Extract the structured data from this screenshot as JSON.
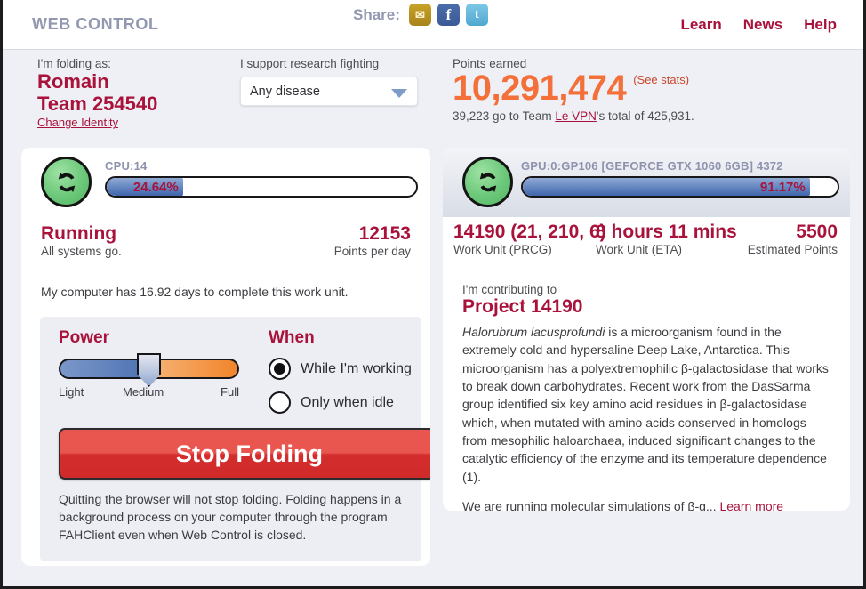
{
  "header": {
    "brand": "WEB CONTROL",
    "share_label": "Share:",
    "share_icons": [
      {
        "name": "email-share-icon",
        "glyph": "✉"
      },
      {
        "name": "facebook-share-icon",
        "glyph": "f"
      },
      {
        "name": "twitter-share-icon",
        "glyph": "t"
      }
    ],
    "nav": [
      {
        "label": "Learn"
      },
      {
        "label": "News"
      },
      {
        "label": "Help"
      }
    ],
    "link_color": "#a8123b"
  },
  "identity": {
    "folding_as_label": "I'm folding as:",
    "user_name": "Romain",
    "team": "Team 254540",
    "change_identity": "Change Identity"
  },
  "disease": {
    "label": "I support research fighting",
    "selected": "Any disease",
    "placeholder": "Any disease",
    "options": [
      "Any disease"
    ]
  },
  "points": {
    "label": "Points earned",
    "value": "10,291,474",
    "see_stats": "(See stats)",
    "note_prefix": "39,223 go to Team ",
    "team_link": "Le VPN",
    "note_suffix": "'s total of 425,931.",
    "accent_color": "#f4703a"
  },
  "slots": [
    {
      "id": "cpu",
      "status_icon": "refresh-icon",
      "name": "CPU:14",
      "progress_percent": 24.64,
      "progress_text": "24.64%",
      "active": true,
      "status_title": "Running",
      "status_sub": "All systems go.",
      "ppd_value": "12153",
      "ppd_label": "Points per day",
      "work_note": "My computer has 16.92 days to complete this work unit."
    },
    {
      "id": "gpu",
      "status_icon": "refresh-icon",
      "name": "GPU:0:GP106 [GEFORCE GTX 1060 6GB] 4372",
      "progress_percent": 91.17,
      "progress_text": "91.17%",
      "active": false,
      "prcg_value": "14190 (21, 210, 6)",
      "prcg_label": "Work Unit (PRCG)",
      "eta_value": "8 hours 11 mins",
      "eta_label": "Work Unit (ETA)",
      "est_value": "5500",
      "est_label": "Estimated Points"
    }
  ],
  "power": {
    "title": "Power",
    "level": "Medium",
    "labels": {
      "light": "Light",
      "medium": "Medium",
      "full": "Full"
    }
  },
  "when": {
    "title": "When",
    "options": [
      {
        "label": "While I'm working",
        "selected": true
      },
      {
        "label": "Only when idle",
        "selected": false
      }
    ]
  },
  "actions": {
    "stop_folding": "Stop Folding",
    "quit_note": "Quitting the browser will not stop folding. Folding happens in a background process on your computer through the program FAHClient even when Web Control is closed."
  },
  "project": {
    "contributing_label": "I'm contributing to",
    "title": "Project 14190",
    "organism": "Halorubrum lacusprofundi",
    "description_rest": " is a microorganism found in the extremely cold and hypersaline Deep Lake, Antarctica. This microorganism has a polyextremophilic β-galactosidase that works to break down carbohydrates. Recent work from the DasSarma group identified six key amino acid residues in β-galactosidase which, when mutated with amino acids conserved in homologs from mesophilic haloarchaea, induced significant changes to the catalytic efficiency of the enzyme and its temperature dependence (1).",
    "description_2": "We are running molecular simulations of β-g...",
    "learn_more": "Learn more"
  }
}
